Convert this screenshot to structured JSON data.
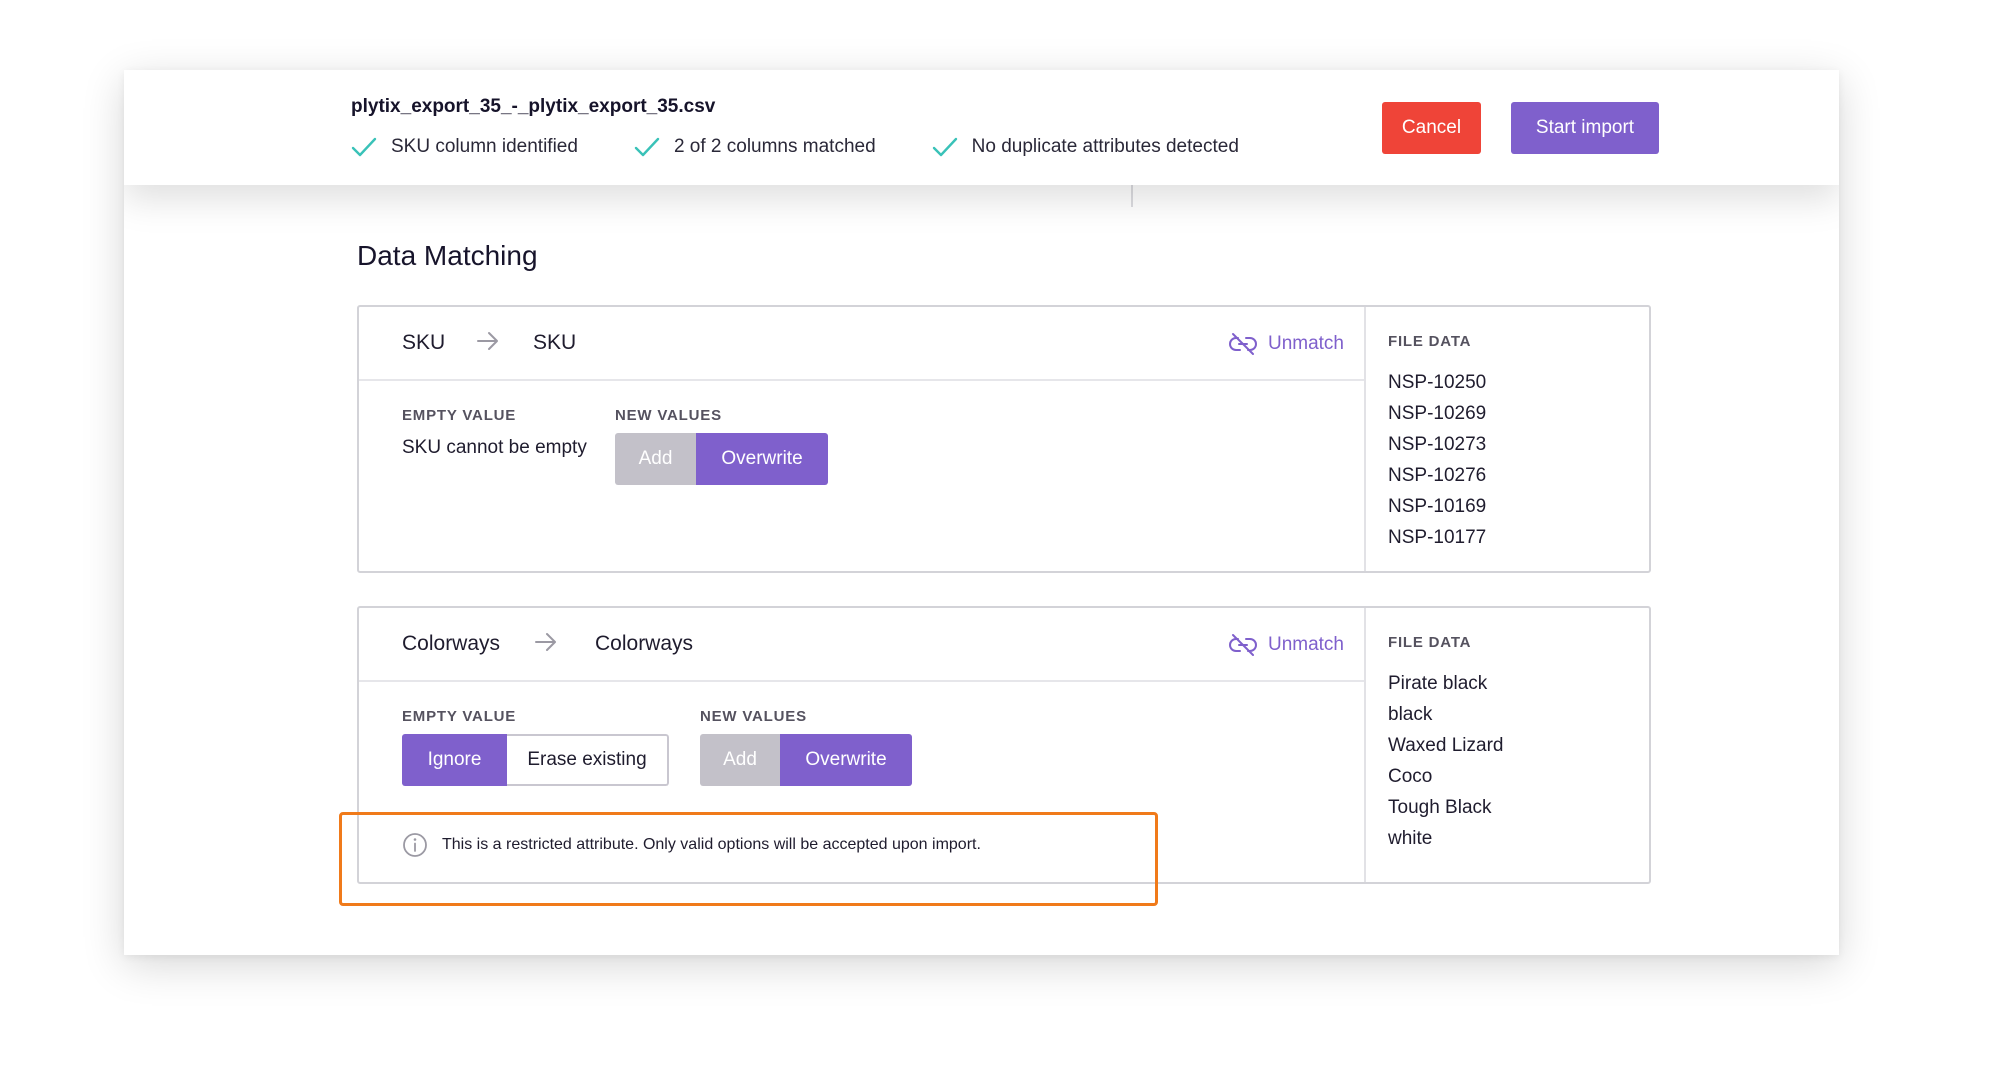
{
  "header": {
    "file_name": "plytix_export_35_-_plytix_export_35.csv",
    "checks": [
      {
        "label": "SKU column identified"
      },
      {
        "label": "2 of 2 columns matched"
      },
      {
        "label": "No duplicate attributes detected"
      }
    ],
    "cancel_label": "Cancel",
    "start_label": "Start import"
  },
  "colors": {
    "accent": "#7f60cc",
    "danger": "#ef4438",
    "check": "#39c2b8",
    "highlight": "#f07a1a"
  },
  "section": {
    "title": "Data Matching"
  },
  "mappings": [
    {
      "source": "SKU",
      "target": "SKU",
      "unmatch_label": "Unmatch",
      "empty_value_label": "EMPTY VALUE",
      "empty_value_text": "SKU cannot be empty",
      "new_values_label": "NEW VALUES",
      "new_values_options": [
        "Add",
        "Overwrite"
      ],
      "new_values_selected": "Overwrite",
      "file_data_label": "FILE DATA",
      "file_data": [
        "NSP-10250",
        "NSP-10269",
        "NSP-10273",
        "NSP-10276",
        "NSP-10169",
        "NSP-10177"
      ]
    },
    {
      "source": "Colorways",
      "target": "Colorways",
      "unmatch_label": "Unmatch",
      "empty_value_label": "EMPTY VALUE",
      "empty_value_options": [
        "Ignore",
        "Erase existing"
      ],
      "empty_value_selected": "Ignore",
      "new_values_label": "NEW VALUES",
      "new_values_options": [
        "Add",
        "Overwrite"
      ],
      "new_values_selected": "Overwrite",
      "notice": "This is a restricted attribute. Only valid options will be accepted upon import.",
      "file_data_label": "FILE DATA",
      "file_data": [
        "Pirate black",
        "black",
        "Waxed Lizard",
        "Coco",
        "Tough Black",
        "white"
      ]
    }
  ]
}
